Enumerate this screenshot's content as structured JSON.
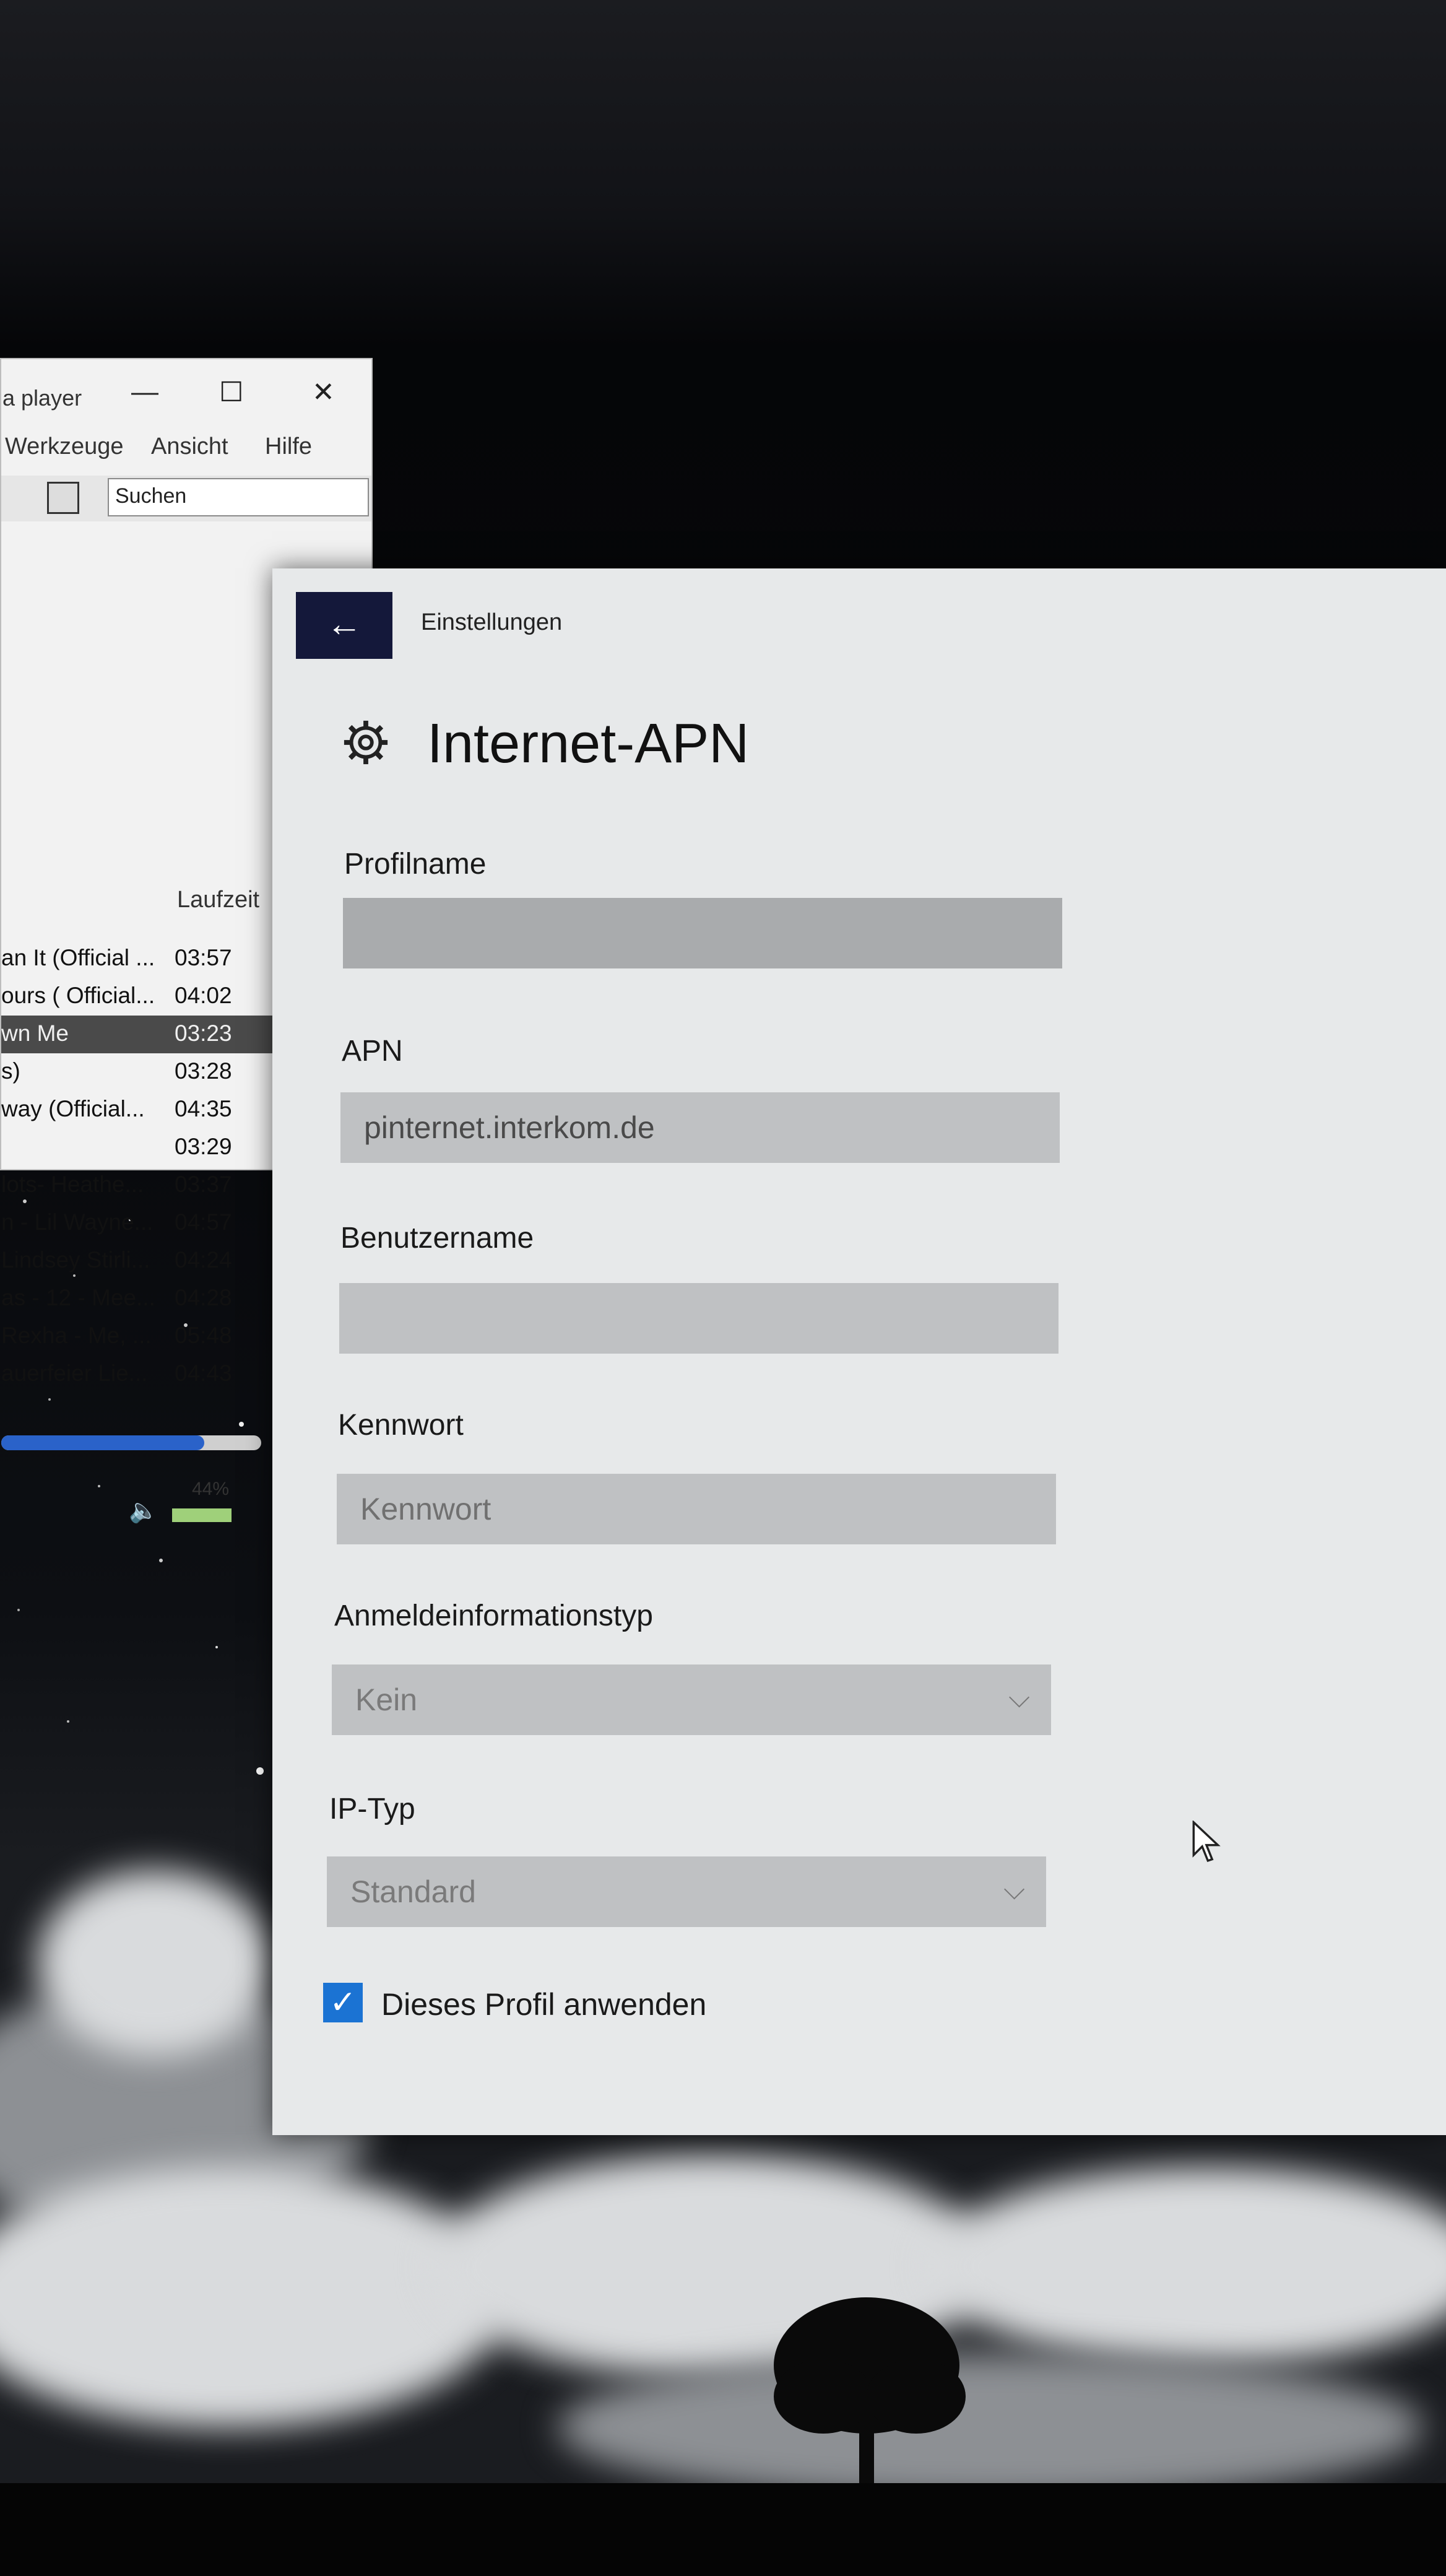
{
  "player": {
    "title": "a player",
    "window_buttons": {
      "minimize": "—",
      "maximize": "☐",
      "close": "✕"
    },
    "menu": [
      "Werkzeuge",
      "Ansicht",
      "Hilfe"
    ],
    "search_value": "Suchen",
    "column_header": "Laufzeit",
    "tracks": [
      {
        "title": "an It (Official ...",
        "duration": "03:57"
      },
      {
        "title": "ours ( Official...",
        "duration": "04:02"
      },
      {
        "title": "wn Me",
        "duration": "03:23"
      },
      {
        "title": "s)",
        "duration": "03:28"
      },
      {
        "title": "way (Official...",
        "duration": "04:35"
      },
      {
        "title": "",
        "duration": "03:29"
      },
      {
        "title": "lots- Heathe...",
        "duration": "03:37"
      },
      {
        "title": "n - Lil Wayne...",
        "duration": "04:57"
      },
      {
        "title": "Lindsey Stirli...",
        "duration": "04:24"
      },
      {
        "title": "as - 12 - Mee...",
        "duration": "04:28"
      },
      {
        "title": " Rexha - Me, ...",
        "duration": "05:48"
      },
      {
        "title": "auerfeier Lie...",
        "duration": "04:43"
      }
    ],
    "selected_index": 2,
    "playback_progress": 0.78,
    "volume_label": "44%"
  },
  "settings": {
    "window_title": "Einstellungen",
    "back_icon": "←",
    "page_title": "Internet-APN",
    "fields": {
      "profilname": {
        "label": "Profilname",
        "value": ""
      },
      "apn": {
        "label": "APN",
        "value": "pinternet.interkom.de"
      },
      "benutzername": {
        "label": "Benutzername",
        "value": ""
      },
      "kennwort": {
        "label": "Kennwort",
        "placeholder": "Kennwort"
      },
      "anmeldeinformationstyp": {
        "label": "Anmeldeinformationstyp",
        "selected": "Kein"
      },
      "ip_typ": {
        "label": "IP-Typ",
        "selected": "Standard"
      }
    },
    "chevron": "⌵",
    "apply_profile": {
      "label": "Dieses Profil anwenden",
      "checked": true,
      "check_glyph": "✓"
    },
    "accent_color": "#1b73d3",
    "back_button_color": "#14183a"
  }
}
